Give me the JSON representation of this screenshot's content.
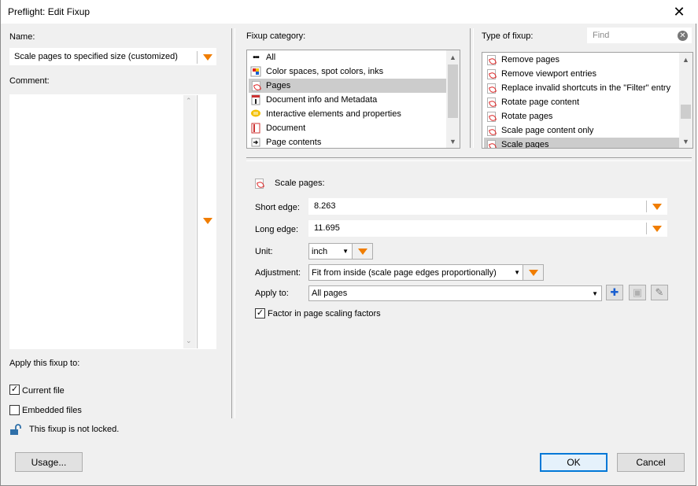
{
  "window": {
    "title": "Preflight: Edit Fixup"
  },
  "left": {
    "name_label": "Name:",
    "name_value": "Scale pages to specified size (customized)",
    "comment_label": "Comment:",
    "apply_label": "Apply this fixup to:",
    "current_file": {
      "label": "Current file",
      "checked": true
    },
    "embedded_files": {
      "label": "Embedded files",
      "checked": false
    },
    "lock_text": "This fixup is not locked."
  },
  "category": {
    "label": "Fixup category:",
    "items": [
      {
        "label": "All",
        "icon": "dots-icon",
        "selected": false
      },
      {
        "label": "Color spaces, spot colors, inks",
        "icon": "color-spaces-icon",
        "selected": false
      },
      {
        "label": "Pages",
        "icon": "pdf-page-icon",
        "selected": true
      },
      {
        "label": "Document info and Metadata",
        "icon": "document-info-icon",
        "selected": false
      },
      {
        "label": "Interactive elements and properties",
        "icon": "speech-bubble-icon",
        "selected": false
      },
      {
        "label": "Document",
        "icon": "document-icon",
        "selected": false
      },
      {
        "label": "Page contents",
        "icon": "page-contents-icon",
        "selected": false
      }
    ]
  },
  "type": {
    "label": "Type of fixup:",
    "find_placeholder": "Find",
    "items": [
      {
        "label": "Remove pages",
        "selected": false
      },
      {
        "label": "Remove viewport entries",
        "selected": false
      },
      {
        "label": "Replace invalid shortcuts in the \"Filter\" entry",
        "selected": false
      },
      {
        "label": "Rotate page content",
        "selected": false
      },
      {
        "label": "Rotate pages",
        "selected": false
      },
      {
        "label": "Scale page content only",
        "selected": false
      },
      {
        "label": "Scale pages",
        "selected": true
      }
    ]
  },
  "settings": {
    "header": "Scale pages:",
    "short_edge_label": "Short edge:",
    "short_edge_value": "8.263",
    "long_edge_label": "Long edge:",
    "long_edge_value": "11.695",
    "unit_label": "Unit:",
    "unit_value": "inch",
    "adjustment_label": "Adjustment:",
    "adjustment_value": "Fit from inside (scale page edges proportionally)",
    "apply_to_label": "Apply to:",
    "apply_to_value": "All pages",
    "factor_label": "Factor in page scaling factors",
    "factor_checked": true
  },
  "buttons": {
    "usage": "Usage...",
    "ok": "OK",
    "cancel": "Cancel"
  },
  "colors": {
    "accent_dropdown": "#f07d00",
    "selection": "#cccccc",
    "default_button_border": "#0078d7"
  }
}
